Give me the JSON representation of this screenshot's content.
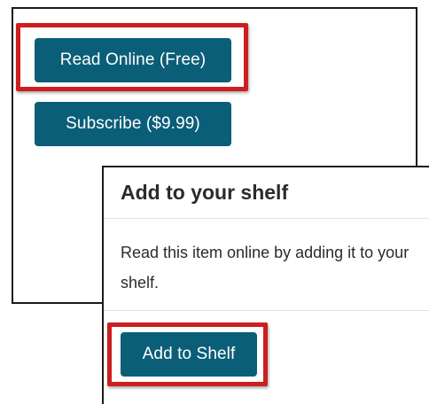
{
  "buttons": {
    "read_online": "Read Online (Free)",
    "subscribe": "Subscribe ($9.99)"
  },
  "dialog": {
    "title": "Add to your shelf",
    "body": "Read this item online by adding it to your shelf.",
    "add_button": "Add to Shelf"
  },
  "colors": {
    "button": "#0b5e78",
    "highlight": "#cc1f1f",
    "text": "#2b2b2b"
  }
}
